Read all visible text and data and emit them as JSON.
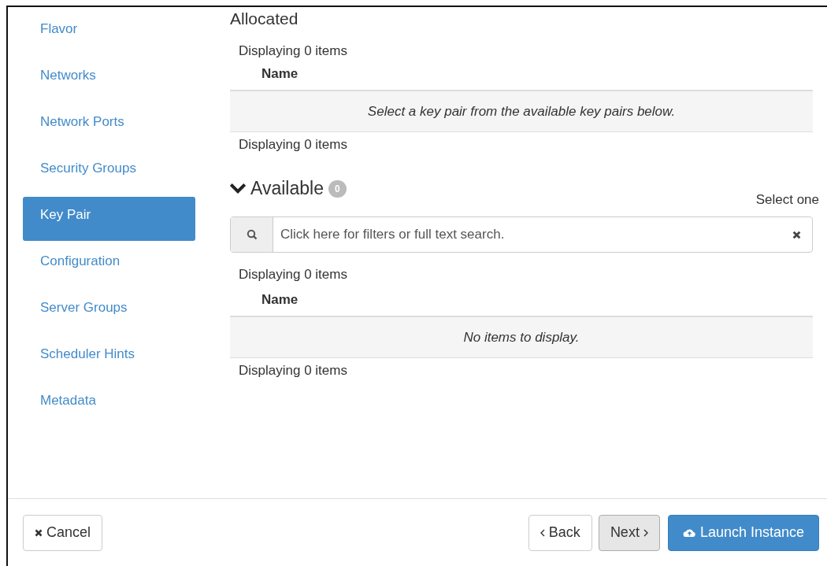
{
  "sidebar": {
    "items": [
      {
        "label": "Flavor",
        "selected": false
      },
      {
        "label": "Networks",
        "selected": false
      },
      {
        "label": "Network Ports",
        "selected": false
      },
      {
        "label": "Security Groups",
        "selected": false
      },
      {
        "label": "Key Pair",
        "selected": true
      },
      {
        "label": "Configuration",
        "selected": false
      },
      {
        "label": "Server Groups",
        "selected": false
      },
      {
        "label": "Scheduler Hints",
        "selected": false
      },
      {
        "label": "Metadata",
        "selected": false
      }
    ]
  },
  "allocated": {
    "title": "Allocated",
    "count_top": "Displaying 0 items",
    "column": "Name",
    "empty_message": "Select a key pair from the available key pairs below.",
    "count_bottom": "Displaying 0 items"
  },
  "available": {
    "title": "Available",
    "badge": "0",
    "expanded": true,
    "hint": "Select one",
    "search": {
      "placeholder": "Click here for filters or full text search."
    },
    "count_top": "Displaying 0 items",
    "column": "Name",
    "empty_message": "No items to display.",
    "count_bottom": "Displaying 0 items"
  },
  "footer": {
    "cancel": "Cancel",
    "back": "Back",
    "next": "Next",
    "launch": "Launch Instance"
  }
}
